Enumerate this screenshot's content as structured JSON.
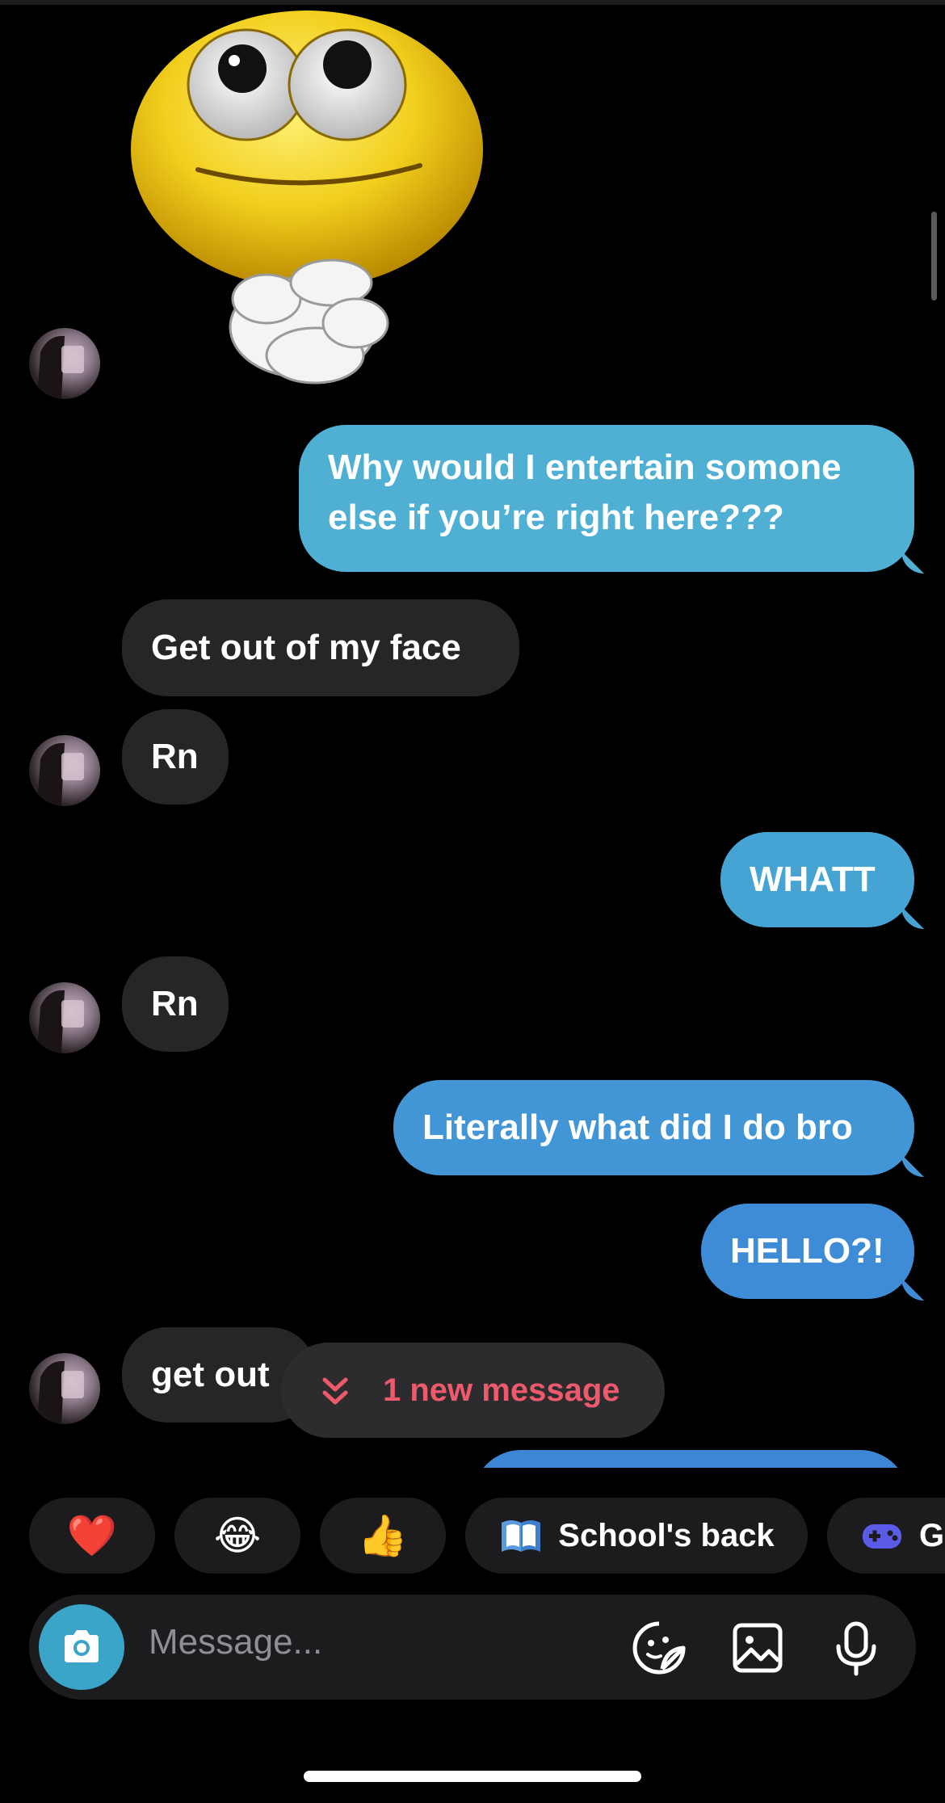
{
  "conversation": {
    "messages": [
      {
        "id": "m1",
        "side": "out",
        "text": "Why would I entertain somone else if you’re right here???"
      },
      {
        "id": "m2",
        "side": "in",
        "text": "Get out of my face"
      },
      {
        "id": "m3",
        "side": "in",
        "text": "Rn"
      },
      {
        "id": "m4",
        "side": "out",
        "text": "WHATT"
      },
      {
        "id": "m5",
        "side": "in",
        "text": "Rn"
      },
      {
        "id": "m6",
        "side": "out",
        "text": "Literally what did I do bro"
      },
      {
        "id": "m7",
        "side": "out",
        "text": "HELLO?!"
      },
      {
        "id": "m8",
        "side": "in",
        "text": "get out"
      }
    ],
    "new_message_pill": "1 new message"
  },
  "quick_replies": [
    {
      "emoji": "❤️"
    },
    {
      "emoji": "😂"
    },
    {
      "emoji": "👍"
    },
    {
      "icon": "book-icon",
      "label": "School's back"
    },
    {
      "icon": "gamepad-icon",
      "label": "Ga"
    }
  ],
  "composer": {
    "placeholder": "Message..."
  },
  "colors": {
    "outgoing_top": "#4fb0d4",
    "outgoing_bottom": "#3d86d6",
    "incoming": "#262628",
    "accent_pill_text": "#ee5a6b",
    "camera_button": "#3aa5c9"
  }
}
